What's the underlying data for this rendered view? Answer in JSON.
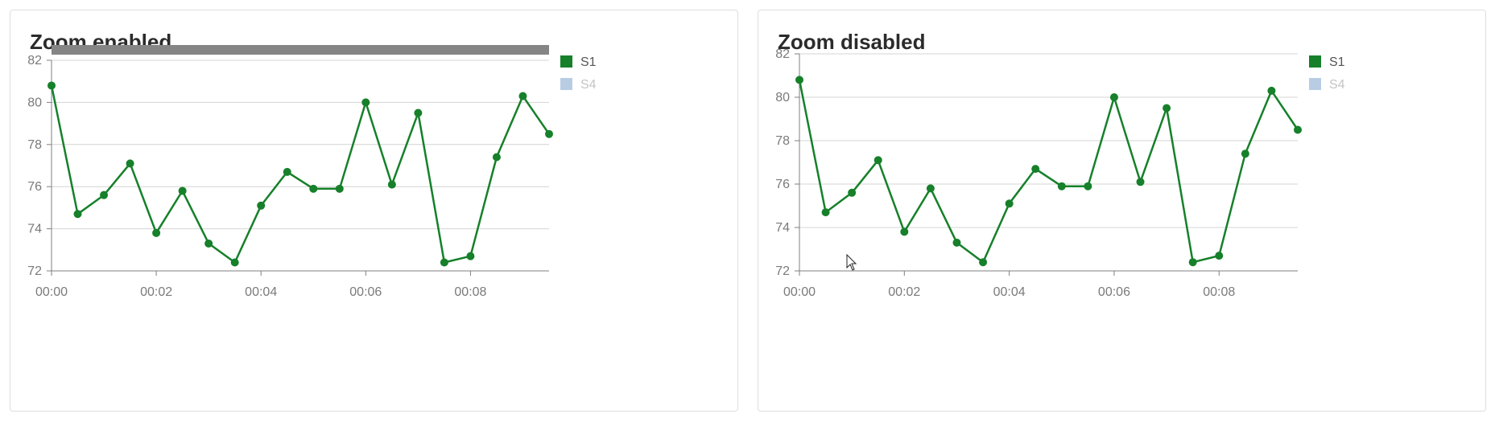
{
  "panels": [
    {
      "title": "Zoom enabled",
      "zoom_enabled": true
    },
    {
      "title": "Zoom disabled",
      "zoom_enabled": false
    }
  ],
  "colors": {
    "s1": "#16802a",
    "s4_hidden": "#b8cce4",
    "legend_hidden_text": "#c4c4c4",
    "grid": "#d4d4d4",
    "axis": "#7f7f7f",
    "zoom_bar": "#858585"
  },
  "chart_data": [
    {
      "type": "line",
      "title": "Zoom enabled",
      "x": [
        "00:00",
        "00:00:30",
        "00:01",
        "00:01:30",
        "00:02",
        "00:02:30",
        "00:03",
        "00:03:30",
        "00:04",
        "00:04:30",
        "00:05",
        "00:05:30",
        "00:06",
        "00:06:30",
        "00:07",
        "00:07:30",
        "00:08",
        "00:08:30",
        "00:09",
        "00:09:30"
      ],
      "x_ticks": [
        "00:00",
        "00:02",
        "00:04",
        "00:06",
        "00:08"
      ],
      "y_ticks": [
        "72",
        "74",
        "76",
        "78",
        "80",
        "82"
      ],
      "ylim": [
        72,
        82
      ],
      "grid": true,
      "legend": "right",
      "zoom_bar": true,
      "series": [
        {
          "name": "S1",
          "visible": true,
          "values": [
            80.8,
            74.7,
            75.6,
            77.1,
            73.8,
            75.8,
            73.3,
            72.4,
            75.1,
            76.7,
            75.9,
            75.9,
            80.0,
            76.1,
            79.5,
            72.4,
            72.7,
            77.4,
            80.3,
            78.5
          ]
        },
        {
          "name": "S4",
          "visible": false,
          "values": []
        }
      ]
    },
    {
      "type": "line",
      "title": "Zoom disabled",
      "x": [
        "00:00",
        "00:00:30",
        "00:01",
        "00:01:30",
        "00:02",
        "00:02:30",
        "00:03",
        "00:03:30",
        "00:04",
        "00:04:30",
        "00:05",
        "00:05:30",
        "00:06",
        "00:06:30",
        "00:07",
        "00:07:30",
        "00:08",
        "00:08:30",
        "00:09",
        "00:09:30"
      ],
      "x_ticks": [
        "00:00",
        "00:02",
        "00:04",
        "00:06",
        "00:08"
      ],
      "y_ticks": [
        "72",
        "74",
        "76",
        "78",
        "80",
        "82"
      ],
      "ylim": [
        72,
        82
      ],
      "grid": true,
      "legend": "right",
      "zoom_bar": false,
      "series": [
        {
          "name": "S1",
          "visible": true,
          "values": [
            80.8,
            74.7,
            75.6,
            77.1,
            73.8,
            75.8,
            73.3,
            72.4,
            75.1,
            76.7,
            75.9,
            75.9,
            80.0,
            76.1,
            79.5,
            72.4,
            72.7,
            77.4,
            80.3,
            78.5
          ]
        },
        {
          "name": "S4",
          "visible": false,
          "values": []
        }
      ]
    }
  ]
}
